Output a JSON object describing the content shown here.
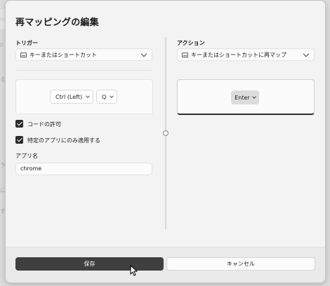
{
  "dialog": {
    "title": "再マッピングの編集",
    "trigger": {
      "label": "トリガー",
      "type_select": "キーまたはショートカット",
      "keys": [
        "Ctrl (Left)",
        "Q"
      ]
    },
    "options": {
      "allow_code": {
        "label": "コードの許可",
        "checked": true
      },
      "app_only": {
        "label": "特定のアプリにのみ適用する",
        "checked": true
      },
      "app_name_label": "アプリ名",
      "app_name_value": "chrome"
    },
    "action": {
      "label": "アクション",
      "type_select": "キーまたはショートカットに再マップ",
      "key": "Enter"
    },
    "footer": {
      "save_label": "保存",
      "cancel_label": "キャンセル"
    }
  },
  "background": {
    "fragments": [
      "ll",
      "る",
      "ラ",
      "に",
      "す"
    ]
  },
  "colors": {
    "primary_button": "#3f3f3f",
    "dialog_bg": "#f3f3f3",
    "footer_bg": "#eaeaea"
  }
}
